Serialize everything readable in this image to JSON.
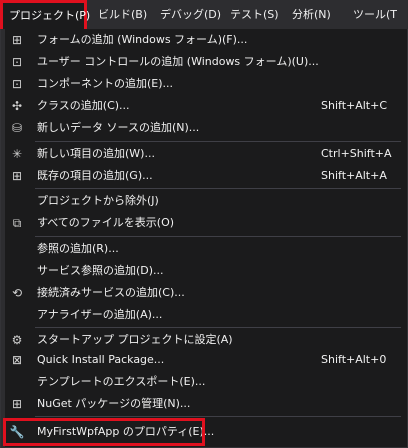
{
  "menubar": {
    "items": [
      {
        "label": "プロジェクト(P)"
      },
      {
        "label": "ビルド(B)"
      },
      {
        "label": "デバッグ(D)"
      },
      {
        "label": "テスト(S)"
      },
      {
        "label": "分析(N)"
      },
      {
        "label": "ツール(T"
      }
    ]
  },
  "menu": {
    "items": [
      {
        "label": "フォームの追加 (Windows フォーム)(F)...",
        "icon": "add-form-icon"
      },
      {
        "label": "ユーザー コントロールの追加 (Windows フォーム)(U)...",
        "icon": "add-user-control-icon"
      },
      {
        "label": "コンポーネントの追加(E)...",
        "icon": "add-component-icon"
      },
      {
        "label": "クラスの追加(C)...",
        "shortcut": "Shift+Alt+C",
        "icon": "add-class-icon"
      },
      {
        "label": "新しいデータ ソースの追加(N)...",
        "icon": "add-data-source-icon"
      },
      {
        "label": "新しい項目の追加(W)...",
        "shortcut": "Ctrl+Shift+A",
        "icon": "add-new-item-icon"
      },
      {
        "label": "既存の項目の追加(G)...",
        "shortcut": "Shift+Alt+A",
        "icon": "add-existing-item-icon"
      },
      {
        "label": "プロジェクトから除外(J)",
        "icon": ""
      },
      {
        "label": "すべてのファイルを表示(O)",
        "icon": "show-all-files-icon"
      },
      {
        "label": "参照の追加(R)...",
        "icon": ""
      },
      {
        "label": "サービス参照の追加(D)...",
        "icon": ""
      },
      {
        "label": "接続済みサービスの追加(C)...",
        "icon": "connected-services-icon"
      },
      {
        "label": "アナライザーの追加(A)...",
        "icon": ""
      },
      {
        "label": "スタートアップ プロジェクトに設定(A)",
        "icon": "gear-icon"
      },
      {
        "label": "Quick Install Package...",
        "shortcut": "Shift+Alt+0",
        "icon": "quick-install-icon"
      },
      {
        "label": "テンプレートのエクスポート(E)...",
        "icon": ""
      },
      {
        "label": "NuGet パッケージの管理(N)...",
        "icon": "nuget-icon"
      },
      {
        "label": "MyFirstWpfApp のプロパティ(E)...",
        "icon": "wrench-icon"
      }
    ]
  },
  "colors": {
    "background": "#1b1b1c",
    "menubar": "#2d2d30",
    "text": "#f1f1f1",
    "highlight_border": "#e0101e",
    "separator": "#3f3f46"
  }
}
